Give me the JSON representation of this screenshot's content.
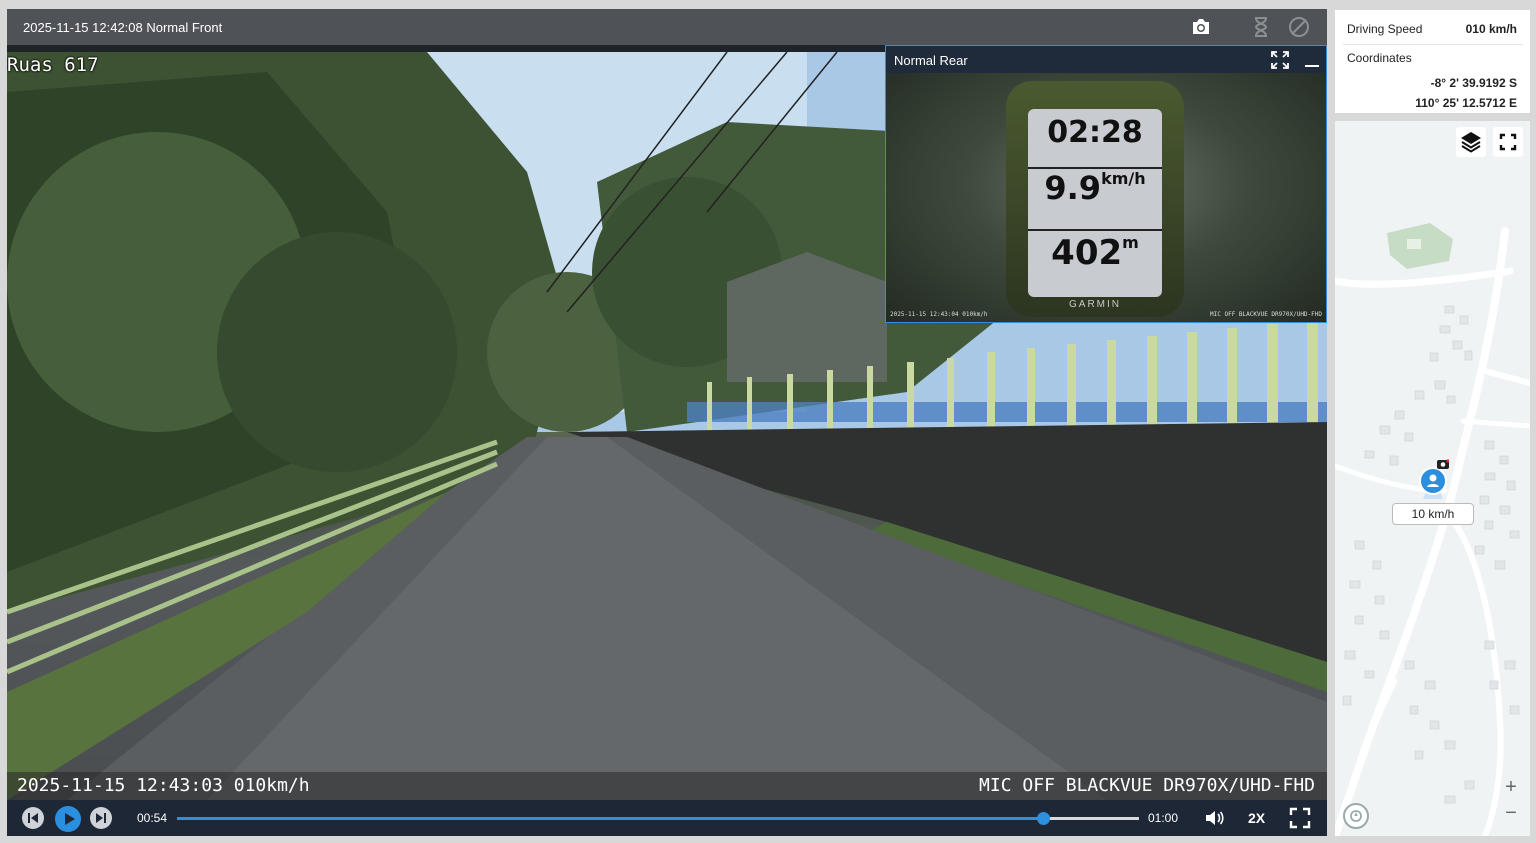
{
  "header": {
    "title": "2025-11-15 12:42:08 Normal Front"
  },
  "front": {
    "label": "Ruas 617",
    "overlay_left": "2025-11-15 12:43:03 010km/h",
    "overlay_right": "MIC OFF BLACKVUE DR970X/UHD-FHD"
  },
  "rear": {
    "title": "Normal Rear",
    "garmin_time": "02:28",
    "garmin_speed": "9.9",
    "garmin_speed_unit": "km/h",
    "garmin_distance": "402",
    "garmin_distance_unit": "m",
    "garmin_brand": "GARMIN",
    "overlay_left": "2025-11-15 12:43:04 010km/h",
    "overlay_right": "MIC OFF BLACKVUE DR970X/UHD-FHD"
  },
  "controls": {
    "current_time": "00:54",
    "total_time": "01:00",
    "progress": 0.9,
    "speed": "2X"
  },
  "info": {
    "speed_label": "Driving Speed",
    "speed_value": "010 km/h",
    "coord_label": "Coordinates",
    "lat": "-8° 2' 39.9192 S",
    "lng": "110° 25' 12.5712 E"
  },
  "map": {
    "speed_tag": "10 km/h",
    "zoom_in": "+",
    "zoom_out": "−",
    "accent": "#2b8fe0"
  },
  "icons": [
    "camera-icon",
    "play-icon",
    "prev-icon",
    "next-icon",
    "volume-icon",
    "fullscreen-icon",
    "layers-icon",
    "compass-icon"
  ]
}
